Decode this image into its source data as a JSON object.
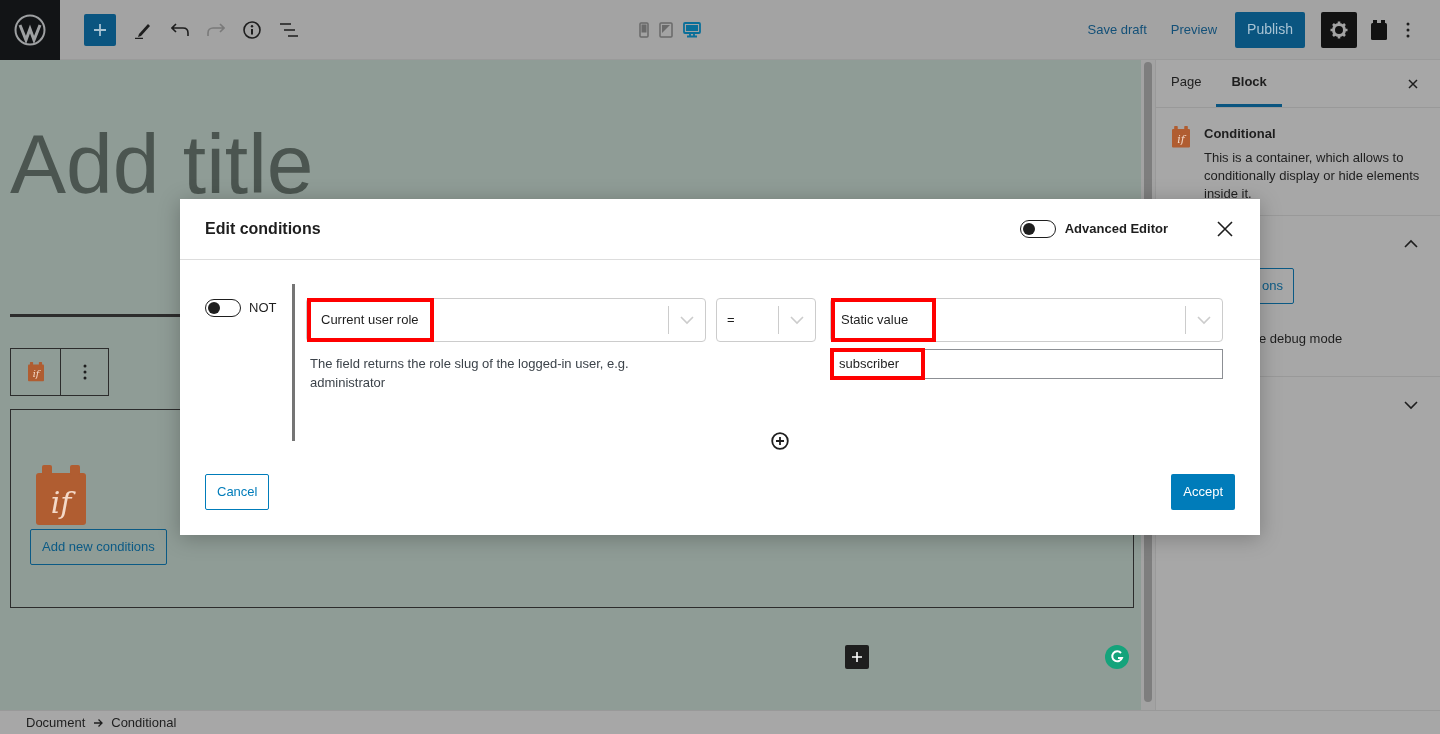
{
  "toolbar": {
    "devices": [
      {
        "kind": "mobile",
        "selected": false
      },
      {
        "kind": "tablet",
        "selected": false
      },
      {
        "kind": "desktop",
        "selected": true
      }
    ],
    "save_draft": "Save draft",
    "preview": "Preview",
    "publish": "Publish"
  },
  "canvas": {
    "title_placeholder": "Add title",
    "block_toolbar": {
      "icon_text": "if"
    },
    "block": {
      "icon_text": "if",
      "button": "Add new conditions"
    }
  },
  "sidebar": {
    "tabs": [
      {
        "label": "Page",
        "selected": false
      },
      {
        "label": "Block",
        "selected": true
      }
    ],
    "block": {
      "icon_text": "if",
      "title": "Conditional",
      "description": "This is a container, which allows to conditionally display or hide elements inside it."
    },
    "panels": [
      {
        "expanded": true
      },
      {
        "expanded": false
      }
    ],
    "button_fragment": "ons",
    "option_fragment": "e debug mode"
  },
  "modal": {
    "title": "Edit conditions",
    "advanced_editor": {
      "label": "Advanced Editor",
      "on": false
    },
    "condition": {
      "not": {
        "label": "NOT",
        "on": false
      },
      "field": {
        "value": "Current user role",
        "highlighted": true
      },
      "help": "The field returns the role slug of the logged-in user, e.g. administrator",
      "operator": {
        "value": "=",
        "highlighted": false
      },
      "value_type": {
        "value": "Static value",
        "highlighted": true
      },
      "value": {
        "value": "subscriber",
        "highlighted": true
      }
    },
    "cancel": "Cancel",
    "accept": "Accept"
  },
  "breadcrumb": [
    "Document",
    "Conditional"
  ]
}
